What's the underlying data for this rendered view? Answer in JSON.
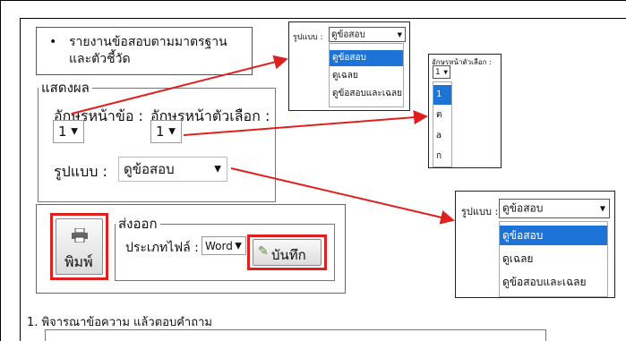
{
  "report_option": "รายงานข้อสอบตามมาตรฐานและตัวชี้วัด",
  "display": {
    "legend": "แสดงผล",
    "question_prefix_label": "อักษรหน้าข้อ :",
    "question_prefix_value": "1",
    "choice_prefix_label": "อักษรหน้าตัวเลือก :",
    "choice_prefix_value": "1",
    "format_label": "รูปแบบ :",
    "format_value": "ดูข้อสอบ"
  },
  "print_button": "พิมพ์",
  "export": {
    "legend": "ส่งออก",
    "file_type_label": "ประเภทไฟล์ :",
    "file_type_value": "Word",
    "save_button": "บันทึก"
  },
  "question_1": "1. พิจารณาข้อความ แล้วตอบคำถาม",
  "popup_format_small": {
    "label": "รูปแบบ :",
    "value": "ดูข้อสอบ",
    "options": [
      "ดูข้อสอบ",
      "ดูเฉลย",
      "ดูข้อสอบและเฉลย"
    ],
    "selected_index": 0
  },
  "popup_choice_prefix": {
    "label": "อักษรหน้าตัวเลือก :",
    "value": "1",
    "options": [
      "1",
      "ต",
      "a",
      "ก"
    ],
    "selected_index": 0
  },
  "popup_format_large": {
    "label": "รูปแบบ :",
    "value": "ดูข้อสอบ",
    "options": [
      "ดูข้อสอบ",
      "ดูเฉลย",
      "ดูข้อสอบและเฉลย"
    ],
    "selected_index": 0
  },
  "colors": {
    "highlight": "#e0201e",
    "arrow": "#e0201e",
    "selected_option": "#1e73d6"
  }
}
